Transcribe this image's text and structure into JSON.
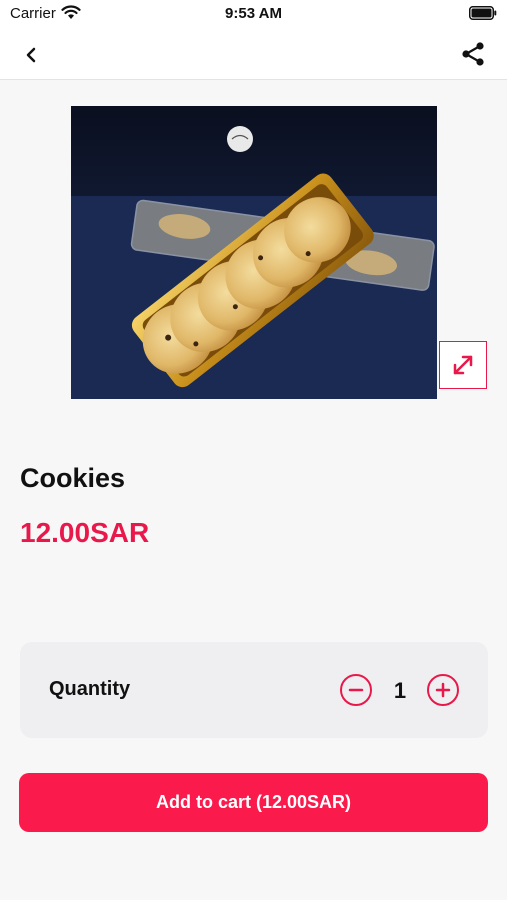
{
  "status_bar": {
    "carrier": "Carrier",
    "time": "9:53 AM"
  },
  "nav": {
    "back_icon": "chevron-left-icon",
    "share_icon": "share-icon"
  },
  "product": {
    "image_icon": "cookies-photo",
    "expand_icon": "expand-icon",
    "name": "Cookies",
    "price": "12.00SAR"
  },
  "quantity": {
    "label": "Quantity",
    "value": "1",
    "minus_icon": "minus-circle-icon",
    "plus_icon": "plus-circle-icon"
  },
  "cart": {
    "button_label": "Add to cart (12.00SAR)"
  },
  "colors": {
    "accent": "#e8194a",
    "button": "#fa1a4b",
    "background": "#f7f7f8"
  }
}
